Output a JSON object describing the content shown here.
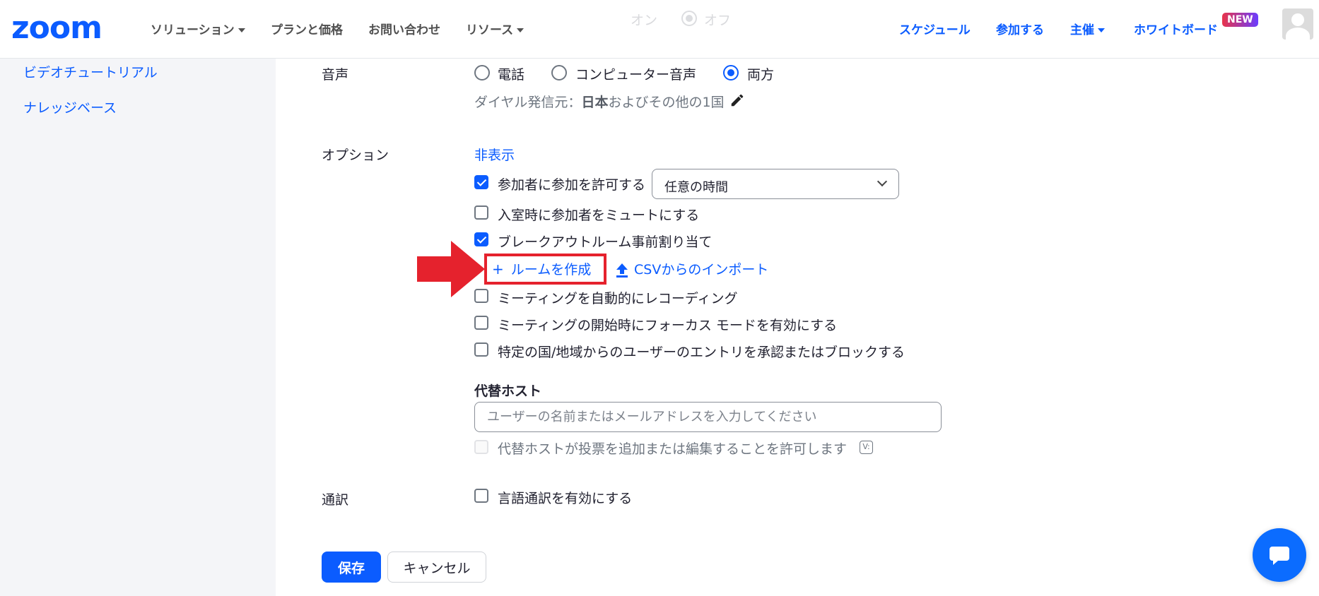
{
  "topnav": {
    "logo": "zoom",
    "items": [
      {
        "label": "ソリューション",
        "dropdown": true
      },
      {
        "label": "プランと価格"
      },
      {
        "label": "お問い合わせ"
      },
      {
        "label": "リソース",
        "dropdown": true
      }
    ],
    "right_items": [
      {
        "label": "スケジュール"
      },
      {
        "label": "参加する"
      },
      {
        "label": "主催",
        "dropdown": true
      },
      {
        "label": "ホワイトボード"
      }
    ],
    "new_badge": "NEW",
    "ghost_on": "オン",
    "ghost_off": "オフ"
  },
  "sidebar": {
    "links": [
      "ビデオチュートリアル",
      "ナレッジベース"
    ]
  },
  "audio": {
    "label": "音声",
    "options": [
      "電話",
      "コンピューター音声",
      "両方"
    ],
    "selected": "両方",
    "dial_prefix": "ダイヤル発信元：",
    "dial_bold": "日本",
    "dial_suffix": "およびその他の1国"
  },
  "options": {
    "label": "オプション",
    "toggle_link": "非表示",
    "allow_join": {
      "label": "参加者に参加を許可する",
      "checked": true,
      "select_value": "任意の時間"
    },
    "mute_on_entry": {
      "label": "入室時に参加者をミュートにする",
      "checked": false
    },
    "breakout_preassign": {
      "label": "ブレークアウトルーム事前割り当て",
      "checked": true
    },
    "create_room": "ルームを作成",
    "import_csv": "CSVからのインポート",
    "auto_record": {
      "label": "ミーティングを自動的にレコーディング",
      "checked": false
    },
    "focus_mode": {
      "label": "ミーティングの開始時にフォーカス モードを有効にする",
      "checked": false
    },
    "region_block": {
      "label": "特定の国/地域からのユーザーのエントリを承認またはブロックする",
      "checked": false
    }
  },
  "alt_host": {
    "label": "代替ホスト",
    "placeholder": "ユーザーの名前またはメールアドレスを入力してください",
    "allow_poll": "代替ホストが投票を追加または編集することを許可します"
  },
  "interpretation": {
    "label": "通訳",
    "enable": "言語通訳を有効にする"
  },
  "actions": {
    "save": "保存",
    "cancel": "キャンセル"
  },
  "colors": {
    "accent": "#0b5cff",
    "highlight_red": "#e5222d"
  }
}
